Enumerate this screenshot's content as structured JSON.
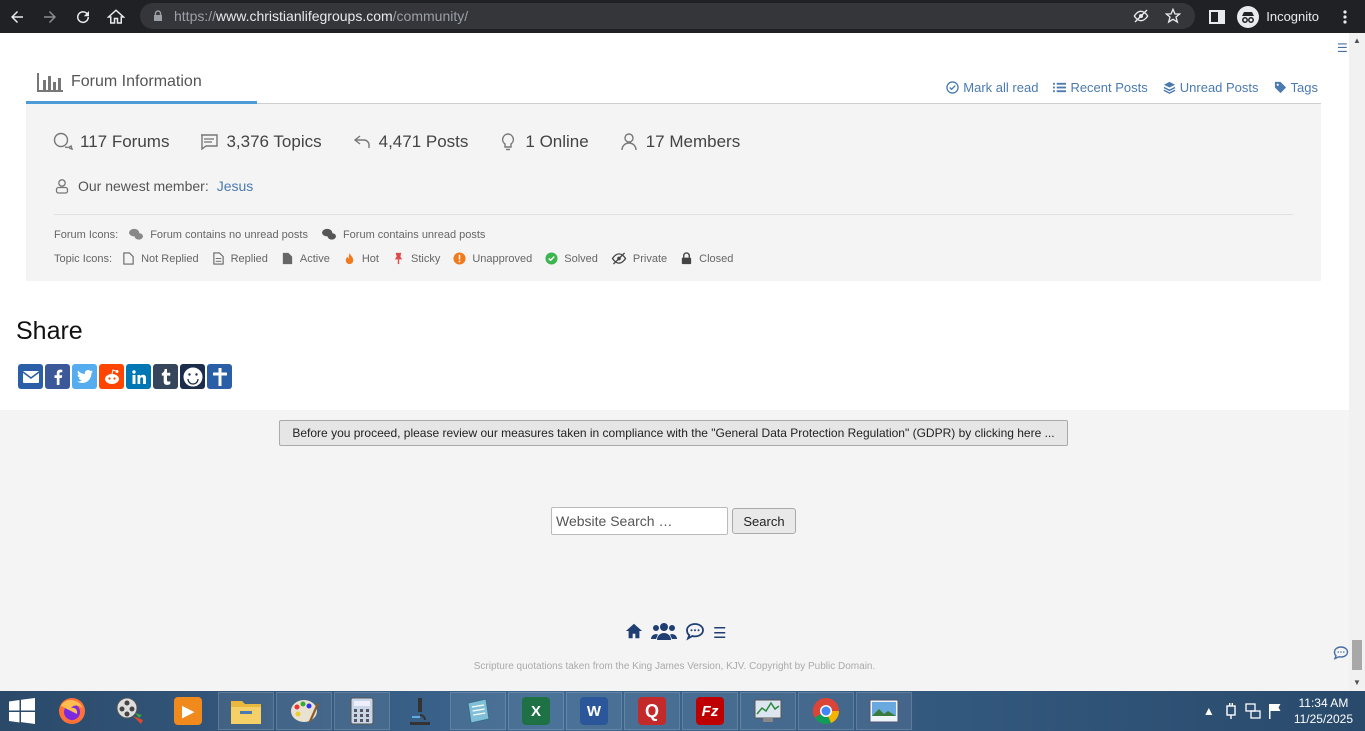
{
  "browser": {
    "url_scheme": "https://",
    "url_host": "www.christianlifegroups.com",
    "url_path": "/community/",
    "profile_label": "Incognito"
  },
  "forum_info": {
    "title": "Forum Information",
    "links": [
      "Mark all read",
      "Recent Posts",
      "Unread Posts",
      "Tags"
    ],
    "stats": [
      {
        "icon": "forums-icon",
        "text": "117 Forums"
      },
      {
        "icon": "topics-icon",
        "text": "3,376 Topics"
      },
      {
        "icon": "posts-icon",
        "text": "4,471 Posts"
      },
      {
        "icon": "online-icon",
        "text": "1 Online"
      },
      {
        "icon": "members-icon",
        "text": "17 Members"
      }
    ],
    "newest_label": "Our newest member:",
    "newest_member": "Jesus",
    "forum_icons_label": "Forum Icons:",
    "forum_icons": [
      "Forum contains no unread posts",
      "Forum contains unread posts"
    ],
    "topic_icons_label": "Topic Icons:",
    "topic_icons": [
      "Not Replied",
      "Replied",
      "Active",
      "Hot",
      "Sticky",
      "Unapproved",
      "Solved",
      "Private",
      "Closed"
    ]
  },
  "share": {
    "title": "Share",
    "colors": {
      "email": "#2a5fa8",
      "facebook": "#3b5998",
      "twitter": "#55acee",
      "reddit": "#ff4500",
      "linkedin": "#0077b5",
      "tumblr": "#35465c",
      "smiley": "#1b2d4a",
      "cross": "#2a5fa8"
    }
  },
  "gdpr_button": "Before you proceed, please review our measures taken in compliance with the \"General Data Protection Regulation\" (GDPR) by clicking here ...",
  "search": {
    "placeholder": "Website Search …",
    "button": "Search"
  },
  "footer": {
    "text": "Scripture quotations taken from the King James Version, KJV. Copyright by Public Domain."
  },
  "taskbar": {
    "time": "11:34 AM",
    "date": "11/25/2025"
  },
  "colors": {
    "accent": "#4a9bd6",
    "link": "#4a7ab0",
    "nav_dark": "#1f3f73"
  }
}
